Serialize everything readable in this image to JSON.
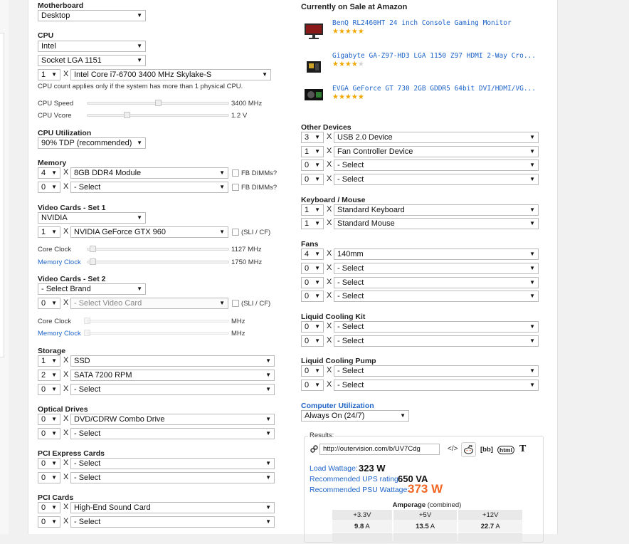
{
  "motherboard": {
    "label": "Motherboard",
    "value": "Desktop"
  },
  "cpu": {
    "label": "CPU",
    "brand": "Intel",
    "socket": "Socket LGA 1151",
    "count": "1",
    "x": "X",
    "model": "Intel Core i7-6700 3400 MHz Skylake-S",
    "note": "CPU count applies only if the system has more than 1 physical CPU.",
    "speed_label": "CPU Speed",
    "speed_value": "3400 MHz",
    "speed_level": 0.5,
    "vcore_label": "CPU Vcore",
    "vcore_value": "1.2 V",
    "vcore_level": 0.28
  },
  "utilization": {
    "label": "CPU Utilization",
    "value": "90% TDP (recommended)"
  },
  "memory": {
    "label": "Memory",
    "rows": [
      {
        "count": "4",
        "value": "8GB DDR4 Module",
        "check": "FB DIMMs?"
      },
      {
        "count": "0",
        "value": "- Select",
        "check": "FB DIMMs?"
      }
    ]
  },
  "video1": {
    "label": "Video Cards - Set 1",
    "brand": "NVIDIA",
    "count": "1",
    "card": "NVIDIA GeForce GTX 960",
    "sli": "(SLI / CF)",
    "core_label": "Core Clock",
    "core_value": "1127 MHz",
    "core_level": 0.04,
    "mem_label": "Memory Clock",
    "mem_value": "1750 MHz",
    "mem_level": 0.04
  },
  "video2": {
    "label": "Video Cards - Set 2",
    "brand": "- Select Brand",
    "count": "0",
    "card": "- Select Video Card",
    "sli": "(SLI / CF)",
    "core_label": "Core Clock",
    "core_value": "MHz",
    "mem_label": "Memory Clock",
    "mem_value": "MHz"
  },
  "storage": {
    "label": "Storage",
    "rows": [
      {
        "count": "1",
        "value": "SSD"
      },
      {
        "count": "2",
        "value": "SATA 7200 RPM"
      },
      {
        "count": "0",
        "value": "- Select"
      }
    ]
  },
  "optical": {
    "label": "Optical Drives",
    "rows": [
      {
        "count": "0",
        "value": "DVD/CDRW Combo Drive"
      },
      {
        "count": "0",
        "value": "- Select"
      }
    ]
  },
  "pcie": {
    "label": "PCI Express Cards",
    "rows": [
      {
        "count": "0",
        "value": "- Select"
      },
      {
        "count": "0",
        "value": "- Select"
      }
    ]
  },
  "pci": {
    "label": "PCI Cards",
    "rows": [
      {
        "count": "0",
        "value": "High-End Sound Card"
      },
      {
        "count": "0",
        "value": "- Select"
      }
    ]
  },
  "amazon": {
    "heading": "Currently on Sale at Amazon",
    "products": [
      {
        "title": "BenQ RL2460HT 24 inch Console Gaming Monitor",
        "rating": 4.5
      },
      {
        "title": "Gigabyte GA-Z97-HD3 LGA 1150 Z97 HDMI 2-Way Cro...",
        "rating": 4.0
      },
      {
        "title": "EVGA GeForce GT 730 2GB GDDR5 64bit DVI/HDMI/VG...",
        "rating": 4.5
      }
    ]
  },
  "other": {
    "label": "Other Devices",
    "rows": [
      {
        "count": "3",
        "value": "USB 2.0 Device"
      },
      {
        "count": "1",
        "value": "Fan Controller Device"
      },
      {
        "count": "0",
        "value": "- Select"
      },
      {
        "count": "0",
        "value": "- Select"
      }
    ]
  },
  "kbm": {
    "label": "Keyboard / Mouse",
    "rows": [
      {
        "count": "1",
        "value": "Standard Keyboard"
      },
      {
        "count": "1",
        "value": "Standard Mouse"
      }
    ]
  },
  "fans": {
    "label": "Fans",
    "rows": [
      {
        "count": "4",
        "value": "140mm"
      },
      {
        "count": "0",
        "value": "- Select"
      },
      {
        "count": "0",
        "value": "- Select"
      },
      {
        "count": "0",
        "value": "- Select"
      }
    ]
  },
  "liquid_kit": {
    "label": "Liquid Cooling Kit",
    "rows": [
      {
        "count": "0",
        "value": "- Select"
      },
      {
        "count": "0",
        "value": "- Select"
      }
    ]
  },
  "liquid_pump": {
    "label": "Liquid Cooling Pump",
    "rows": [
      {
        "count": "0",
        "value": "- Select"
      },
      {
        "count": "0",
        "value": "- Select"
      }
    ]
  },
  "computer_util": {
    "label": "Computer Utilization",
    "value": "Always On (24/7)"
  },
  "results": {
    "legend": "Results:",
    "url": "http://outervision.com/b/UV7Cdg",
    "code_icon": "</>",
    "bb": "[bb]",
    "html": "html",
    "t": "T",
    "load_label": "Load Wattage:",
    "load_value": "323 W",
    "ups_label": "Recommended UPS rating:",
    "ups_value": "650 VA",
    "psu_label": "Recommended PSU Wattage:",
    "psu_value": "373 W",
    "amp_title": "Amperage",
    "amp_sub": "(combined)",
    "amp_headers": [
      "+3.3V",
      "+5V",
      "+12V"
    ],
    "amp_values": [
      "9.8",
      "13.5",
      "22.7"
    ],
    "amp_unit": "A",
    "link_color": "#1e64c8",
    "psu_color": "#f26522"
  }
}
